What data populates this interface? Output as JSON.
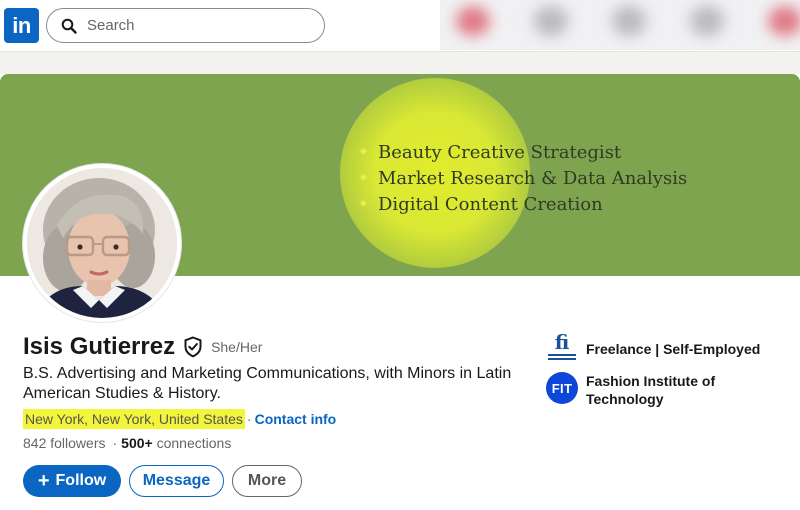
{
  "nav": {
    "logo_text": "in",
    "search_placeholder": "Search"
  },
  "banner": {
    "items": [
      "Beauty Creative Strategist",
      "Market Research & Data Analysis",
      "Digital Content Creation"
    ],
    "bullet": "✷",
    "colors": {
      "background": "#7ea450",
      "glow": "#e2ec2c"
    }
  },
  "profile": {
    "name": "Isis Gutierrez",
    "pronouns": "She/Her",
    "headline": "B.S. Advertising and Marketing Communications, with Minors in Latin American Studies & History.",
    "location": "New York, New York, United States",
    "separator": "·",
    "contact_info": "Contact info",
    "followers_count": "842",
    "followers_label": "followers",
    "connections_count": "500+",
    "connections_label": "connections",
    "stats_separator": "·"
  },
  "actions": {
    "follow": "Follow",
    "follow_icon": "+",
    "message": "Message",
    "more": "More"
  },
  "experience": {
    "current": "Freelance | Self-Employed",
    "logo_text": "fi"
  },
  "education": {
    "school": "Fashion Institute of Technology",
    "logo_text": "FIT"
  },
  "colors": {
    "brand": "#0a66c2",
    "highlight": "#f2f53a"
  }
}
